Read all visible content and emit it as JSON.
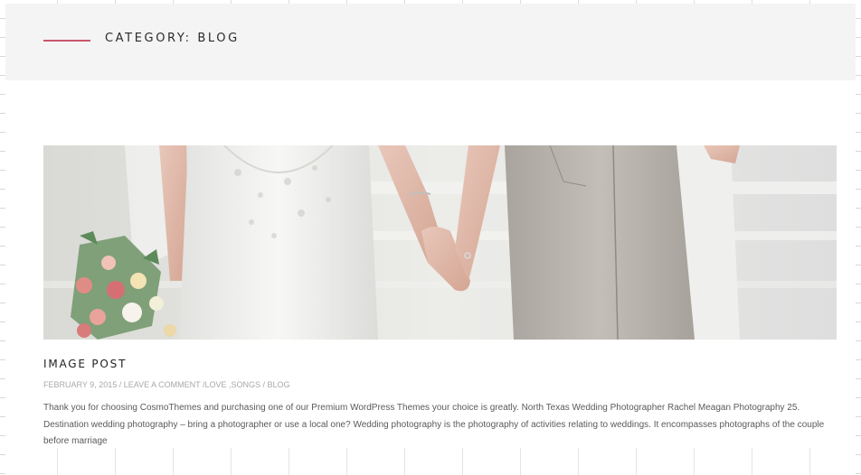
{
  "header": {
    "title": "CATEGORY: BLOG",
    "accent_color": "#c9566b",
    "background": "#f4f4f4"
  },
  "post": {
    "image_alt_icon": "wedding-hands-photo",
    "title": "IMAGE POST",
    "meta": {
      "date": "FEBRUARY 9, 2015",
      "separator1": " / ",
      "comment_link": "LEAVE A COMMENT",
      "separator2": " /",
      "tag1": "LOVE",
      "tag_separator": " ,",
      "tag2": "SONGS",
      "separator3": " / ",
      "category": "BLOG"
    },
    "excerpt": "Thank you for choosing CosmoThemes and purchasing one of our Premium WordPress Themes your choice is greatly. North Texas Wedding Photographer Rachel Meagan Photography 25. Destination wedding photography – bring a photographer or use a local one? Wedding photography is the photography of activities relating to weddings. It encompasses photographs of the couple before marriage"
  }
}
